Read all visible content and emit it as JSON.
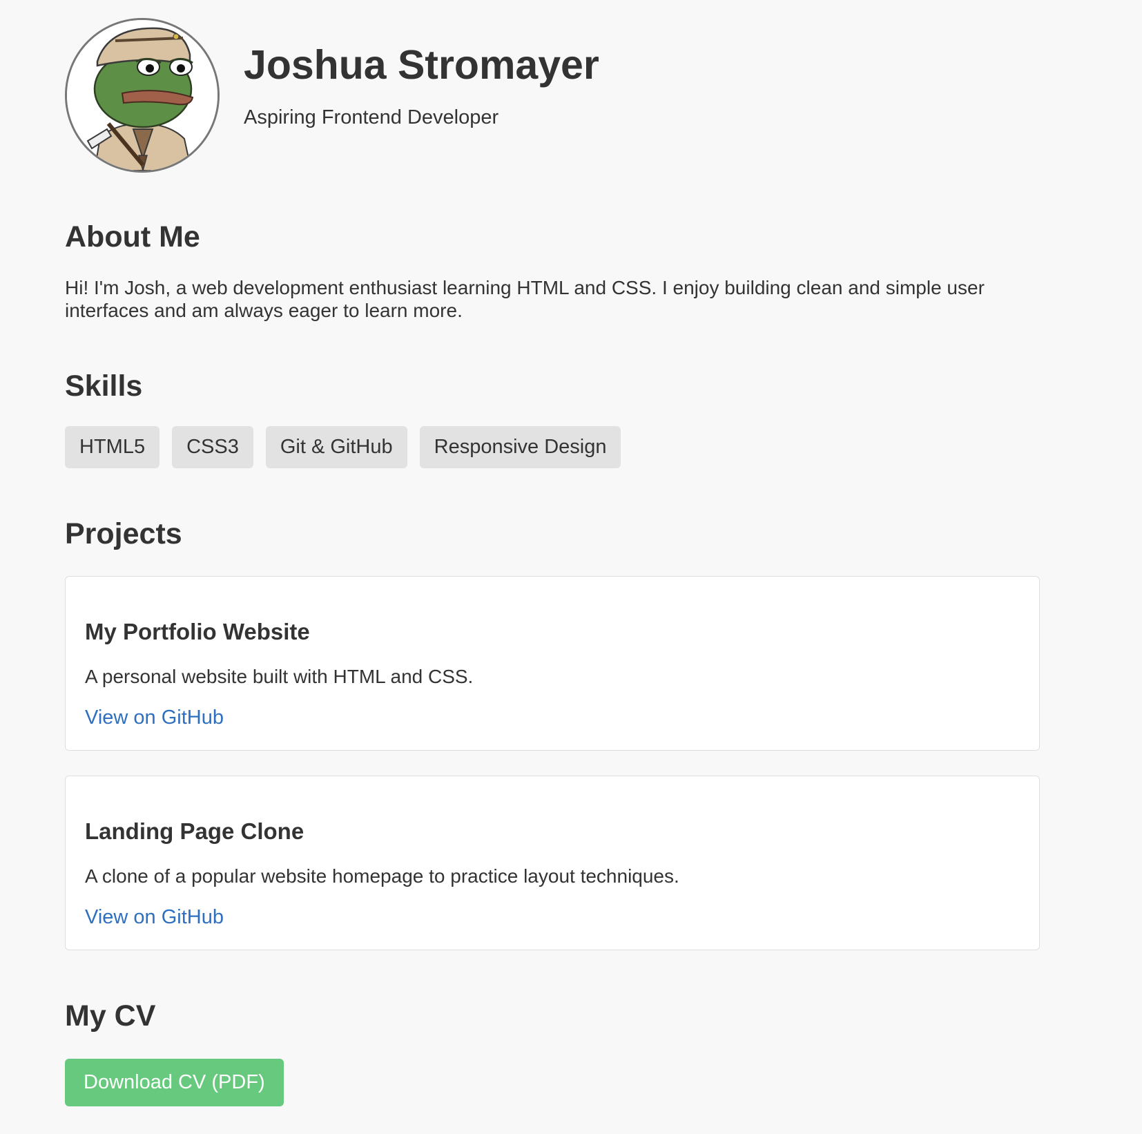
{
  "header": {
    "name": "Joshua Stromayer",
    "tagline": "Aspiring Frontend Developer",
    "avatar_icon": "frog-avatar"
  },
  "about": {
    "title": "About Me",
    "text": "Hi! I'm Josh, a web development enthusiast learning HTML and CSS. I enjoy building clean and simple user interfaces and am always eager to learn more."
  },
  "skills": {
    "title": "Skills",
    "items": [
      {
        "label": "HTML5"
      },
      {
        "label": "CSS3"
      },
      {
        "label": "Git & GitHub"
      },
      {
        "label": "Responsive Design"
      }
    ]
  },
  "projects": {
    "title": "Projects",
    "items": [
      {
        "title": "My Portfolio Website",
        "description": "A personal website built with HTML and CSS.",
        "link_label": "View on GitHub"
      },
      {
        "title": "Landing Page Clone",
        "description": "A clone of a popular website homepage to practice layout techniques.",
        "link_label": "View on GitHub"
      }
    ]
  },
  "cv": {
    "title": "My CV",
    "button_label": "Download CV (PDF)"
  },
  "colors": {
    "background": "#f8f8f8",
    "text": "#333333",
    "link": "#2e6fbf",
    "button": "#66c97d",
    "skill_chip": "#e2e2e2"
  }
}
